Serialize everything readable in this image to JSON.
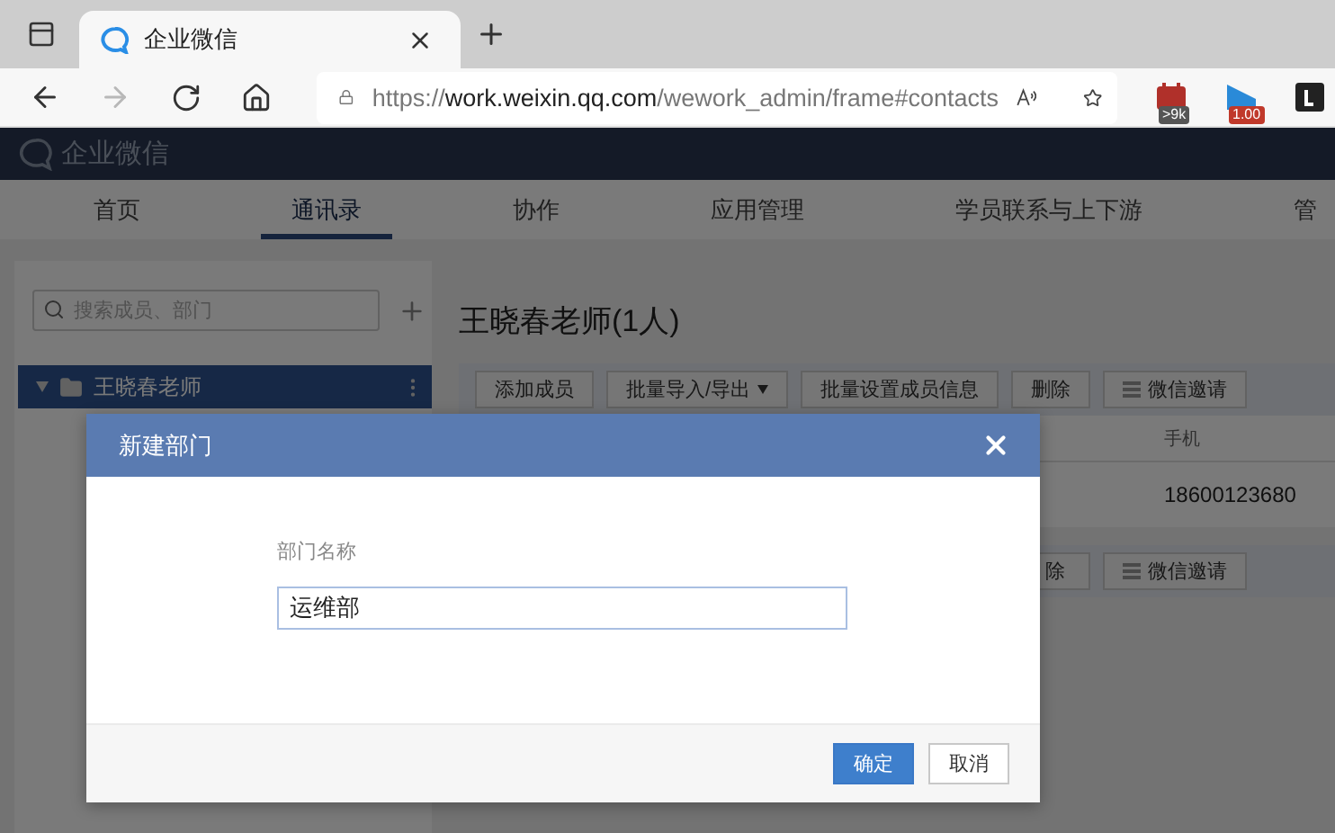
{
  "browser": {
    "tabs": [
      {
        "title": "企业微信",
        "selected": true
      }
    ],
    "address": {
      "scheme": "https://",
      "host": "work.weixin.qq.com",
      "path": "/wework_admin/frame#contacts"
    },
    "forward_disabled": true,
    "extensions": [
      {
        "kind": "calendar",
        "badge": ">9k",
        "color": "#555555"
      },
      {
        "kind": "flag",
        "badge": "1.00",
        "color": "#c0392b"
      },
      {
        "kind": "letter"
      }
    ]
  },
  "app": {
    "logo": "企业微信",
    "nav": [
      {
        "label": "首页",
        "selected": false
      },
      {
        "label": "通讯录",
        "selected": true
      },
      {
        "label": "协作",
        "selected": false
      },
      {
        "label": "应用管理",
        "selected": false
      },
      {
        "label": "学员联系与上下游",
        "selected": false
      },
      {
        "label": "管",
        "selected": false
      }
    ],
    "search": {
      "placeholder": "搜索成员、部门"
    },
    "tree": [
      {
        "label": "王晓春老师",
        "selected": true,
        "expanded": true
      }
    ],
    "department_title": "王晓春老师(1人)",
    "toolbar": [
      {
        "label": "添加成员",
        "kind": "plain"
      },
      {
        "label": "批量导入/导出",
        "kind": "dropdown"
      },
      {
        "label": "批量设置成员信息",
        "kind": "plain"
      },
      {
        "label": "删除",
        "kind": "plain"
      },
      {
        "label": "微信邀请",
        "kind": "wechat"
      }
    ],
    "table": {
      "columns": [
        "手机"
      ],
      "rows": [
        [
          "18600123680"
        ]
      ]
    },
    "bottom_toolbar": [
      {
        "label": "除",
        "kind": "cut"
      },
      {
        "label": "微信邀请",
        "kind": "wechat"
      }
    ]
  },
  "modal": {
    "title": "新建部门",
    "field": {
      "label": "部门名称",
      "value": "运维部"
    },
    "buttons": [
      {
        "label": "确定",
        "kind": "primary"
      },
      {
        "label": "取消",
        "kind": "secondary"
      }
    ]
  }
}
